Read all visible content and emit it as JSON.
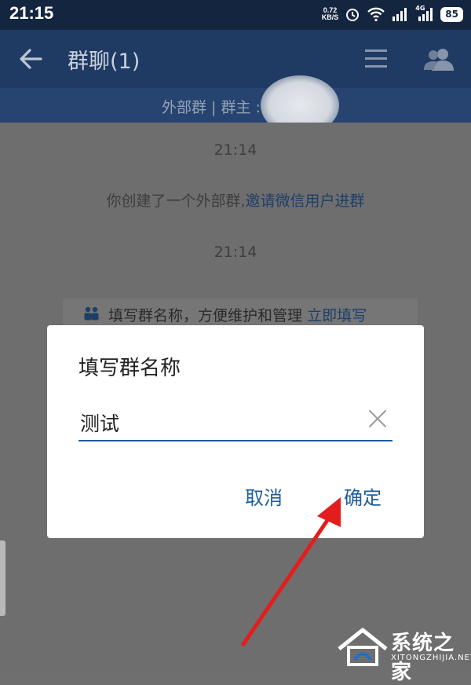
{
  "status": {
    "time": "21:15",
    "net_speed_value": "0.72",
    "net_speed_unit": "KB/S",
    "network_type": "4G",
    "battery": "85"
  },
  "header": {
    "title": "群聊(1)"
  },
  "subheader": {
    "text": "外部群 | 群主 :"
  },
  "chat": {
    "timestamp_1": "21:14",
    "system_message": "你创建了一个外部群,",
    "system_link": "邀请微信用户进群",
    "timestamp_2": "21:14",
    "hint_text": "填写群名称，方便维护和管理",
    "hint_link": "立即填写"
  },
  "dialog": {
    "title": "填写群名称",
    "input_value": "测试",
    "cancel_label": "取消",
    "ok_label": "确定"
  },
  "watermark": {
    "title": "系统之家",
    "subtitle": "XITONGZHIJIA.NET"
  },
  "colors": {
    "appbar": "#1f3a63",
    "dialog_accent": "#1f5e9a",
    "arrow": "#e31d1d"
  },
  "icons": [
    "back-arrow-icon",
    "menu-icon",
    "group-members-icon",
    "clear-icon",
    "group-icon",
    "red-arrow-annotation"
  ]
}
